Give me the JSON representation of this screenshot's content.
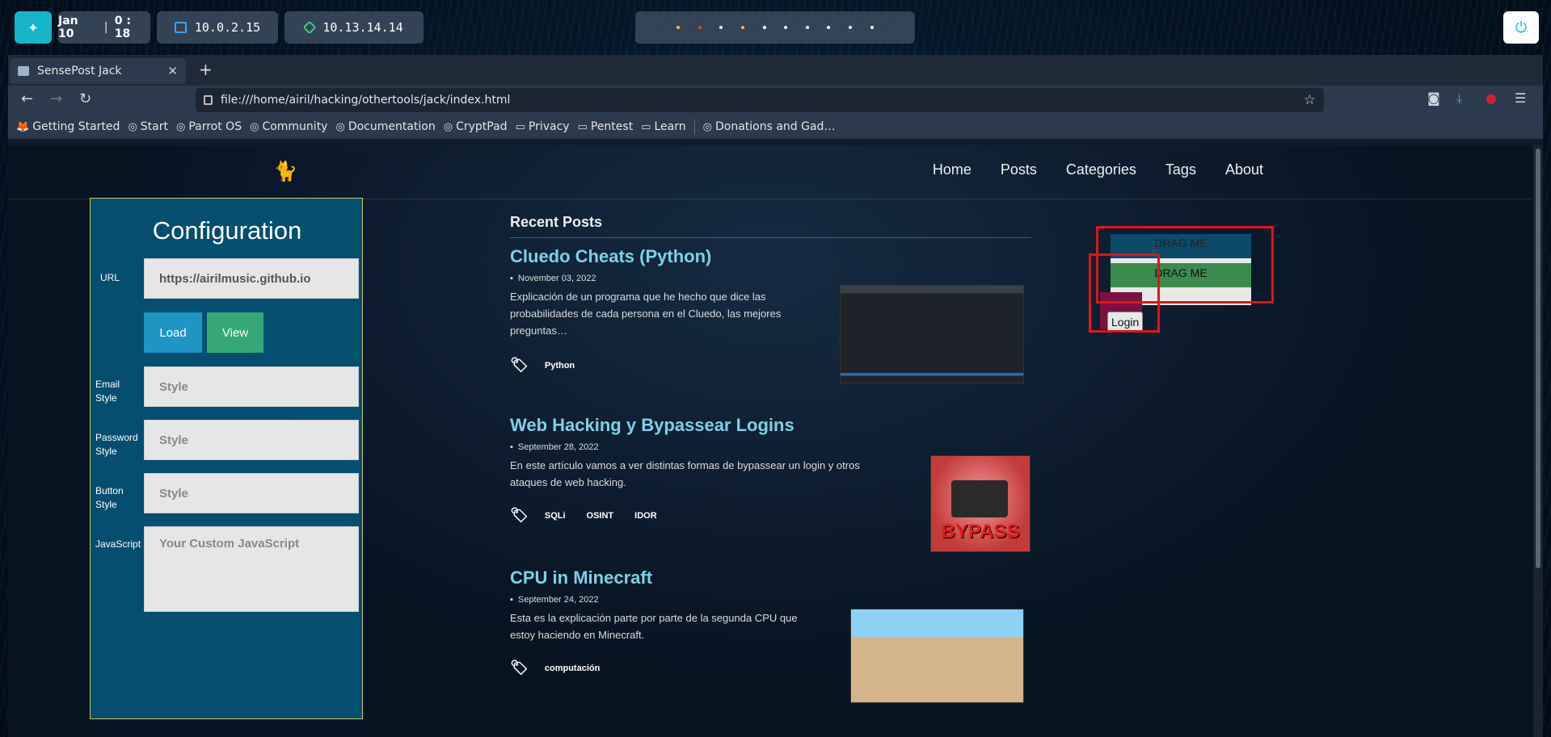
{
  "desktop_panel": {
    "date": "Jan 10",
    "time": "0 : 18",
    "ip_local": "10.0.2.15",
    "ip_vpn": "10.13.14.14",
    "workspace_colors": [
      "#f0c040",
      "#e83a3a",
      "#ffffff",
      "#f0c040",
      "#ffffff",
      "#ffffff",
      "#ffffff",
      "#ffffff",
      "#ffffff",
      "#ffffff"
    ]
  },
  "browser": {
    "tab_title": "SensePost Jack",
    "url": "file:///home/airil/hacking/othertools/jack/index.html",
    "bookmarks": [
      "Getting Started",
      "Start",
      "Parrot OS",
      "Community",
      "Documentation",
      "CryptPad",
      "Privacy",
      "Pentest",
      "Learn",
      "Donations and Gad…"
    ]
  },
  "site": {
    "logo": "🐈",
    "nav": [
      "Home",
      "Posts",
      "Categories",
      "Tags",
      "About"
    ]
  },
  "config": {
    "title": "Configuration",
    "url_label": "URL",
    "url_value": "https://airilmusic.github.io",
    "load_label": "Load",
    "view_label": "View",
    "email_label": "Email Style",
    "email_placeholder": "Style",
    "password_label": "Password Style",
    "password_placeholder": "Style",
    "button_label": "Button Style",
    "button_placeholder": "Style",
    "js_label": "JavaScript",
    "js_placeholder": "Your Custom JavaScript"
  },
  "posts": {
    "heading": "Recent Posts",
    "items": [
      {
        "title": "Cluedo Cheats (Python)",
        "date": "November 03, 2022",
        "excerpt": "Explicación de un programa que he hecho que dice las probabilidades de cada persona en el Cluedo, las mejores preguntas…",
        "tags": [
          "Python"
        ]
      },
      {
        "title": "Web Hacking y Bypassear Logins",
        "date": "September 28, 2022",
        "excerpt": "En este artículo vamos a ver distintas formas de bypassear un login y otros ataques de web hacking.",
        "tags": [
          "SQLi",
          "OSINT",
          "IDOR"
        ],
        "thumb_text": "BYPASS"
      },
      {
        "title": "CPU in Minecraft",
        "date": "September 24, 2022",
        "excerpt": "Esta es la explicación parte por parte de la segunda CPU que estoy haciendo en Minecraft.",
        "tags": [
          "computación"
        ]
      }
    ]
  },
  "clickjack": {
    "drag1": "DRAG ME",
    "drag2": "DRAG ME",
    "login": "Login",
    "highlight_color": "#e1131a"
  }
}
